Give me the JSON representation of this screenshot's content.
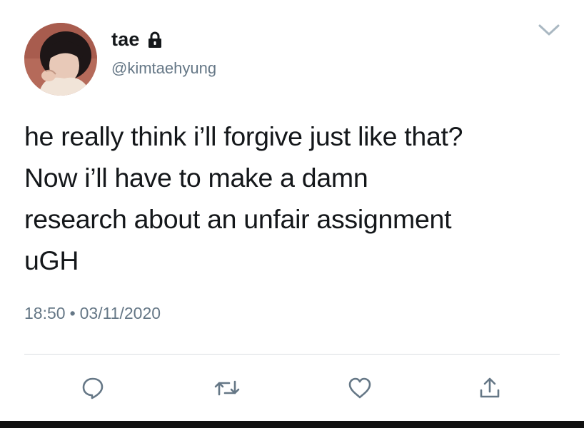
{
  "user": {
    "display_name": "tae",
    "handle": "@kimtaehyung",
    "avatar_icon": "profile-photo",
    "protected_icon": "lock-icon"
  },
  "tweet": {
    "lines": [
      "he really think i’ll forgive just like that?",
      "Now i’ll have to make a damn",
      "research about an unfair assignment",
      "uGH"
    ],
    "time": "18:50",
    "separator": "•",
    "date": "03/11/2020"
  },
  "actions": {
    "icons": [
      "reply-icon",
      "retweet-icon",
      "like-icon",
      "share-icon"
    ]
  },
  "colors": {
    "text": "#14171a",
    "muted": "#657786",
    "divider": "#d9dee2",
    "icon": "#657786"
  }
}
